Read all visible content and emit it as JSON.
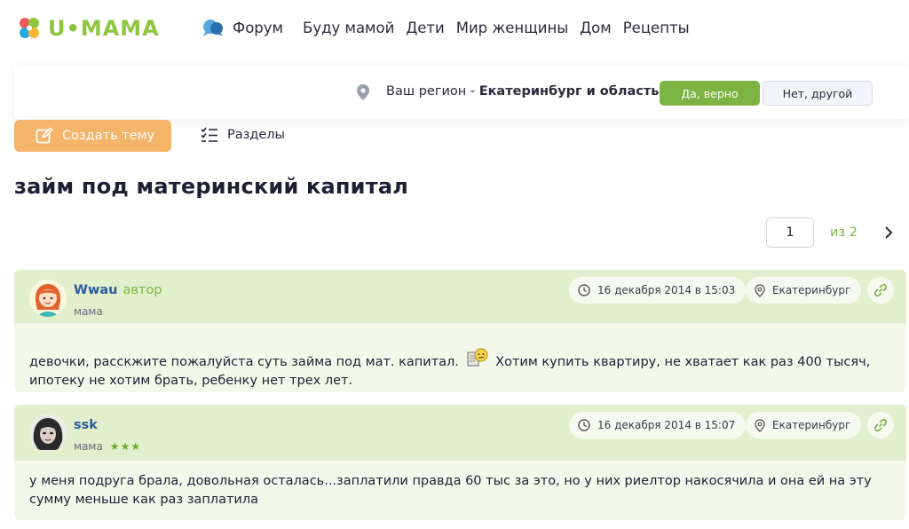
{
  "header": {
    "logo_text": "U•MAMA",
    "nav": {
      "forum": "Форум",
      "items": [
        "Буду мамой",
        "Дети",
        "Мир женщины",
        "Дом",
        "Рецепты"
      ]
    }
  },
  "region": {
    "prefix": "Ваш регион - ",
    "name": "Екатеринбург и область",
    "suffix": "?",
    "yes_label": "Да, верно",
    "no_label": "Нет, другой"
  },
  "actions": {
    "create_topic": "Создать тему",
    "sections": "Разделы"
  },
  "page_title": "займ под материнский капитал",
  "pagination": {
    "current_page": "1",
    "of_label": "из 2"
  },
  "posts": [
    {
      "author": "Wwau",
      "badge": "автор",
      "role": "мама",
      "date": "16 декабря 2014 в 15:03",
      "city": "Екатеринбург",
      "text_before": "девочки, расскжите пожалуйста суть займа под мат. капитал.",
      "text_after": "Хотим купить квартиру, не хватает как раз 400 тысяч, ипотеку не хотим брать, ребенку нет трех лет."
    },
    {
      "author": "ssk",
      "role": "мама",
      "stars": "★★★",
      "date": "16 декабря 2014 в 15:07",
      "city": "Екатеринбург",
      "text": "у меня подруга брала, довольная осталась...заплатили правда 60 тыс за это, но у них риелтор накосячила и она ей на эту сумму меньше как раз заплатила"
    }
  ],
  "colors": {
    "accent_green": "#7cb342",
    "create_orange": "#f4b46a",
    "post_header": "#e2efcd",
    "post_body": "#f3f8ea",
    "author_blue": "#2b5a9e"
  }
}
